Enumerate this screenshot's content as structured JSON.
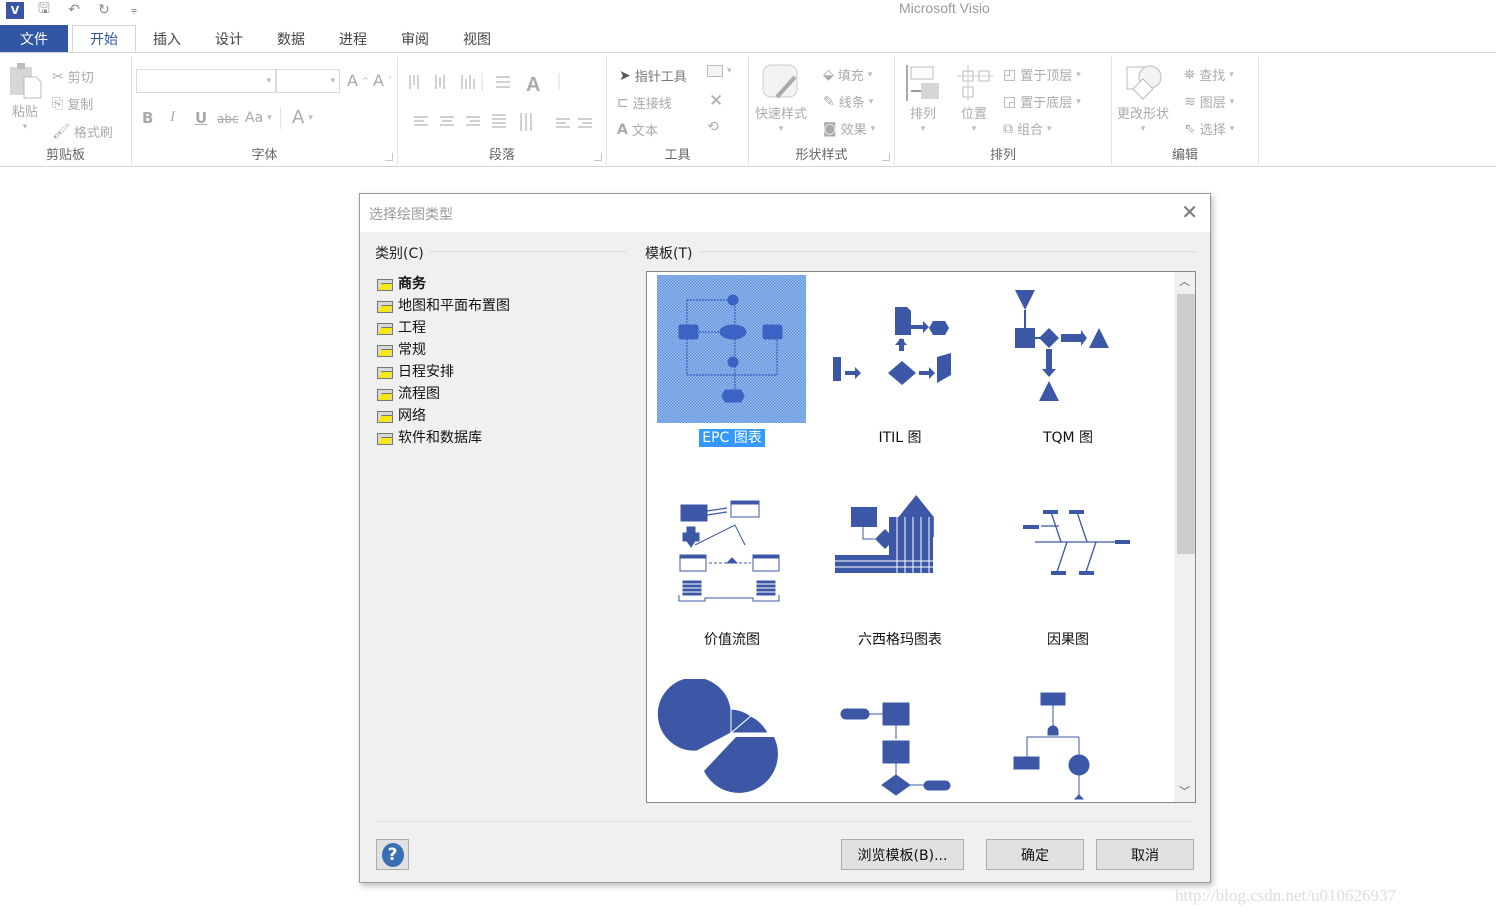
{
  "app": {
    "title": "Microsoft Visio",
    "logo_text": "V"
  },
  "quick_access": [
    {
      "icon": "visio-logo-icon"
    },
    {
      "icon": "save-icon",
      "glyph": "🖫"
    },
    {
      "icon": "undo-icon",
      "glyph": "↶"
    },
    {
      "icon": "redo-icon",
      "glyph": "↻"
    },
    {
      "icon": "customize-qat-icon",
      "glyph": "⩦"
    }
  ],
  "tabs": [
    {
      "label": "文件",
      "id": "file"
    },
    {
      "label": "开始",
      "id": "home",
      "active": true
    },
    {
      "label": "插入",
      "id": "insert"
    },
    {
      "label": "设计",
      "id": "design"
    },
    {
      "label": "数据",
      "id": "data"
    },
    {
      "label": "进程",
      "id": "process"
    },
    {
      "label": "审阅",
      "id": "review"
    },
    {
      "label": "视图",
      "id": "view"
    }
  ],
  "ribbon": {
    "clipboard": {
      "label": "剪贴板",
      "paste": "粘贴",
      "cut": "剪切",
      "copy": "复制",
      "format_painter": "格式刷"
    },
    "font": {
      "label": "字体",
      "font_name": "",
      "font_size": "",
      "bold": "B",
      "italic": "I",
      "underline": "U",
      "strike": "abc",
      "case": "Aa",
      "font_color": "A",
      "grow": "A",
      "shrink": "A"
    },
    "paragraph": {
      "label": "段落"
    },
    "tools": {
      "label": "工具",
      "pointer": "指针工具",
      "connector": "连接线",
      "text": "文本"
    },
    "shape_styles": {
      "label": "形状样式",
      "quick_styles": "快速样式",
      "fill": "填充",
      "line": "线条",
      "effects": "效果"
    },
    "arrange": {
      "label": "排列",
      "align": "排列",
      "position": "位置",
      "bring_front": "置于顶层",
      "send_back": "置于底层",
      "group": "组合"
    },
    "editing": {
      "label": "编辑",
      "change_shape": "更改形状",
      "find": "查找",
      "layers": "图层",
      "select": "选择"
    }
  },
  "dialog": {
    "title": "选择绘图类型",
    "category_label": "类别(C)",
    "template_label": "模板(T)",
    "categories": [
      {
        "label": "商务",
        "selected": true
      },
      {
        "label": "地图和平面布置图"
      },
      {
        "label": "工程"
      },
      {
        "label": "常规"
      },
      {
        "label": "日程安排"
      },
      {
        "label": "流程图"
      },
      {
        "label": "网络"
      },
      {
        "label": "软件和数据库"
      }
    ],
    "templates": [
      {
        "label": "EPC 图表",
        "selected": true,
        "icon": "epc-diagram-icon"
      },
      {
        "label": "ITIL 图",
        "icon": "itil-diagram-icon"
      },
      {
        "label": "TQM 图",
        "icon": "tqm-diagram-icon"
      },
      {
        "label": "价值流图",
        "icon": "value-stream-map-icon"
      },
      {
        "label": "六西格玛图表",
        "icon": "six-sigma-diagram-icon"
      },
      {
        "label": "因果图",
        "icon": "cause-effect-diagram-icon"
      },
      {
        "label": "",
        "icon": "pie-chart-icon"
      },
      {
        "label": "",
        "icon": "flowchart-icon"
      },
      {
        "label": "",
        "icon": "fault-tree-icon"
      }
    ],
    "scroll_position": 0,
    "buttons": {
      "help": "?",
      "browse": "浏览模板(B)...",
      "ok": "确定",
      "cancel": "取消"
    }
  },
  "watermark": "http://blog.csdn.net/u010626937",
  "colors": {
    "accent": "#3056a4",
    "shape_blue": "#3c57a6",
    "selection": "#3399ff"
  }
}
